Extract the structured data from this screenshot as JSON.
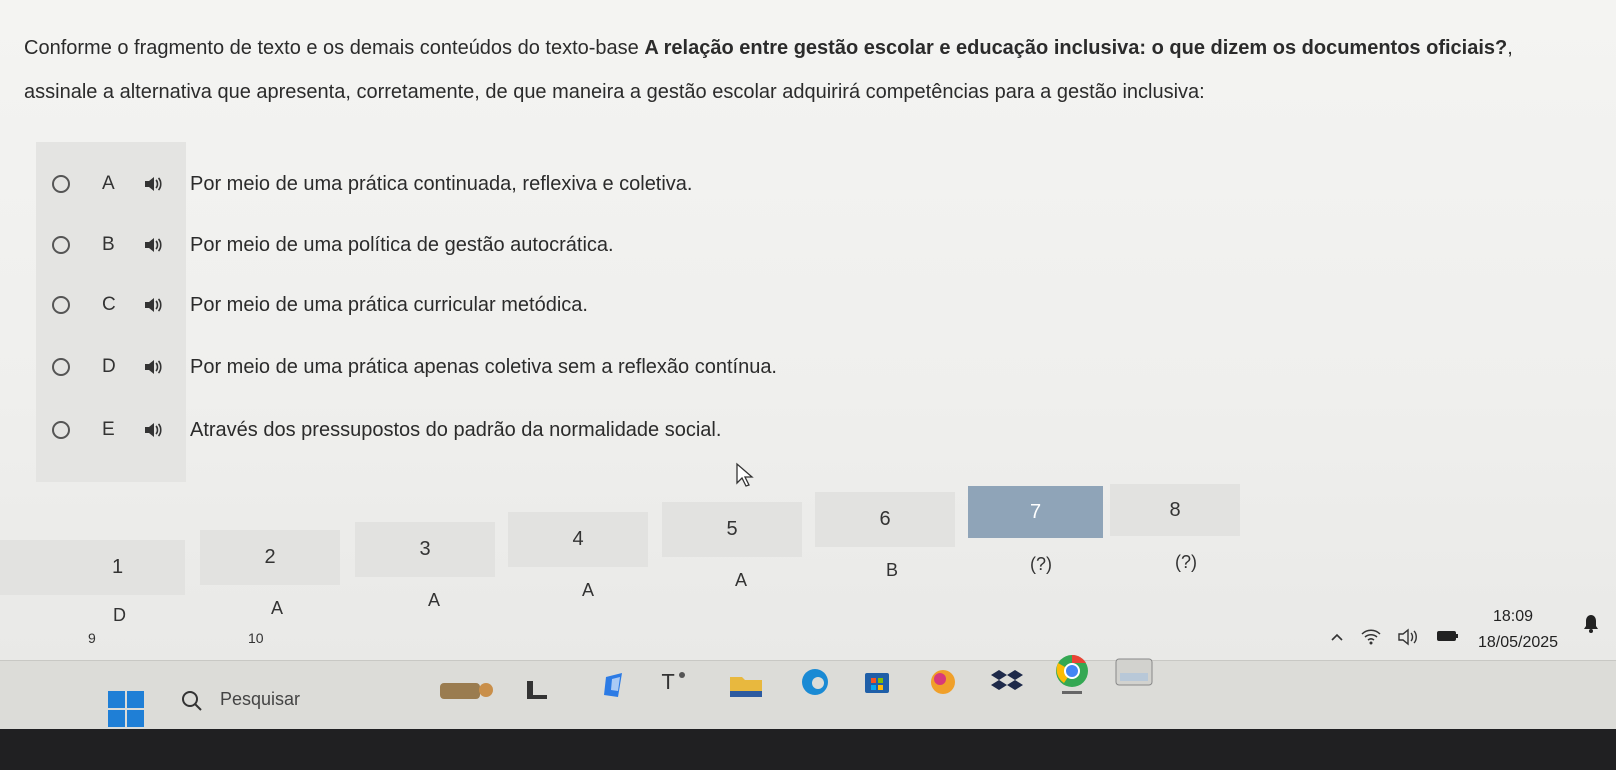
{
  "question": {
    "part1": "Conforme o fragmento de texto e os demais conteúdos do texto-base ",
    "bold": "A relação entre gestão escolar e educação inclusiva: o que dizem os documentos oficiais?",
    "part2": ", assinale a alternativa que apresenta, corretamente, de que maneira a gestão escolar adquirirá competências para a gestão inclusiva:"
  },
  "options": [
    {
      "letter": "A",
      "text": "Por meio de uma prática continuada, reflexiva e coletiva."
    },
    {
      "letter": "B",
      "text": "Por meio de uma política de gestão autocrática."
    },
    {
      "letter": "C",
      "text": "Por meio de uma prática curricular metódica."
    },
    {
      "letter": "D",
      "text": "Por meio de uma prática apenas coletiva sem a reflexão contínua."
    },
    {
      "letter": "E",
      "text": "Através dos pressupostos do padrão da normalidade social."
    }
  ],
  "icons": {
    "speaker": "speaker-icon",
    "cursor": "mouse-pointer-icon"
  },
  "question_nav": [
    {
      "number": "1",
      "answer": "D",
      "active": false
    },
    {
      "number": "2",
      "answer": "A",
      "active": false
    },
    {
      "number": "3",
      "answer": "A",
      "active": false
    },
    {
      "number": "4",
      "answer": "A",
      "active": false
    },
    {
      "number": "5",
      "answer": "A",
      "active": false
    },
    {
      "number": "6",
      "answer": "B",
      "active": false
    },
    {
      "number": "7",
      "answer": "(?)",
      "active": true
    },
    {
      "number": "8",
      "answer": "(?)",
      "active": false
    }
  ],
  "question_nav_row2": [
    "9",
    "10"
  ],
  "colors": {
    "active_cell": "#8fa4b8",
    "cell": "#e2e2e0"
  },
  "system_tray": {
    "time": "18:09",
    "date": "18/05/2025"
  },
  "taskbar": {
    "search_label": "Pesquisar"
  }
}
